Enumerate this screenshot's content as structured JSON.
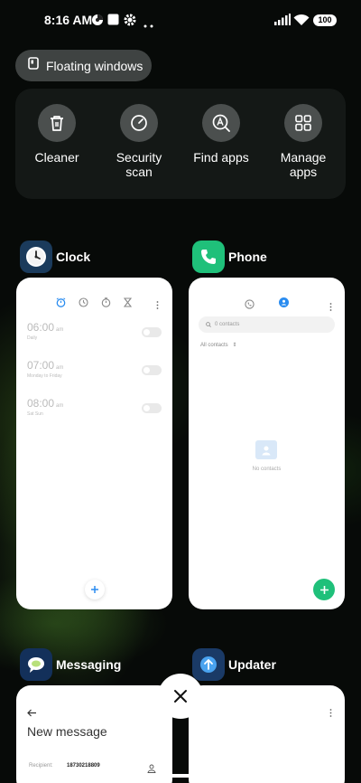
{
  "status_bar": {
    "time": "8:16 AM",
    "battery": "100",
    "icons": [
      "notification-icon",
      "square-icon",
      "gear-icon",
      "more-icon",
      "signal-icon",
      "wifi-icon",
      "battery-icon"
    ]
  },
  "floating_windows": {
    "label": "Floating windows",
    "icon": "floating-window-icon"
  },
  "tools": [
    {
      "label_line1": "Cleaner",
      "label_line2": "",
      "icon": "trash-icon"
    },
    {
      "label_line1": "Security",
      "label_line2": "scan",
      "icon": "security-scan-icon"
    },
    {
      "label_line1": "Find apps",
      "label_line2": "",
      "icon": "find-apps-icon"
    },
    {
      "label_line1": "Manage",
      "label_line2": "apps",
      "icon": "grid-icon"
    }
  ],
  "apps": {
    "clock": {
      "name": "Clock",
      "alarms": [
        {
          "time": "06:00",
          "ampm": "am",
          "repeat": "Daily"
        },
        {
          "time": "07:00",
          "ampm": "am",
          "repeat": "Monday to Friday"
        },
        {
          "time": "08:00",
          "ampm": "am",
          "repeat": "Sat Sun"
        }
      ]
    },
    "phone": {
      "name": "Phone",
      "search_placeholder": "0 contacts",
      "filter": "All contacts",
      "empty": "No contacts"
    },
    "messaging": {
      "name": "Messaging",
      "title": "New message",
      "recipient_label": "Recipient:",
      "recipient_value": "18730218809"
    },
    "updater": {
      "name": "Updater"
    }
  },
  "colors": {
    "accent_blue": "#2a8cf0",
    "phone_green": "#1fc07a",
    "card_bg": "#ffffff"
  }
}
